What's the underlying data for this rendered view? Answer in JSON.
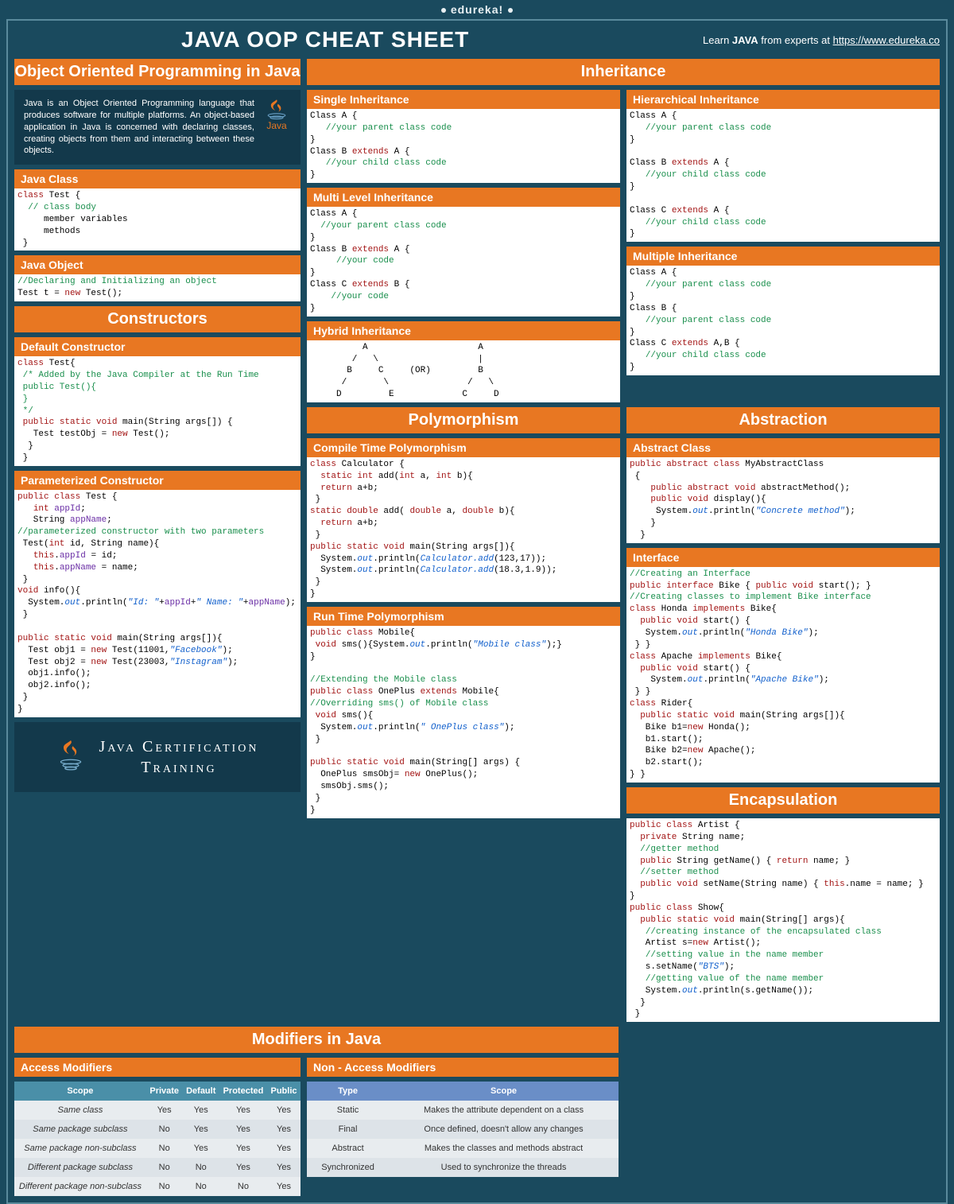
{
  "brand": "edureka!",
  "title": "JAVA OOP CHEAT SHEET",
  "learn_prefix": "Learn ",
  "learn_bold": "JAVA",
  "learn_suffix": " from experts at ",
  "learn_url": "https://www.edureka.co",
  "sec_oop": "Object Oriented Programming in Java",
  "intro": "Java is an Object Oriented Programming language that produces software for multiple platforms. An object-based application in Java is concerned with declaring classes, creating objects from them and interacting between these objects.",
  "java_label": "Java",
  "sec_class": "Java Class",
  "sec_obj": "Java Object",
  "sec_ctor": "Constructors",
  "sec_defctor": "Default Constructor",
  "sec_paramctor": "Parameterized Constructor",
  "cert1": "Java Certification",
  "cert2": "Training",
  "sec_mod": "Modifiers in Java",
  "sec_access": "Access Modifiers",
  "sec_nonaccess": "Non - Access Modifiers",
  "access_headers": [
    "Scope",
    "Private",
    "Default",
    "Protected",
    "Public"
  ],
  "access_rows": [
    [
      "Same class",
      "Yes",
      "Yes",
      "Yes",
      "Yes"
    ],
    [
      "Same package subclass",
      "No",
      "Yes",
      "Yes",
      "Yes"
    ],
    [
      "Same package non-subclass",
      "No",
      "Yes",
      "Yes",
      "Yes"
    ],
    [
      "Different package subclass",
      "No",
      "No",
      "Yes",
      "Yes"
    ],
    [
      "Different package non-subclass",
      "No",
      "No",
      "No",
      "Yes"
    ]
  ],
  "nonaccess_headers": [
    "Type",
    "Scope"
  ],
  "nonaccess_rows": [
    [
      "Static",
      "Makes the attribute dependent on a class"
    ],
    [
      "Final",
      "Once defined, doesn't allow any changes"
    ],
    [
      "Abstract",
      "Makes the classes and methods abstract"
    ],
    [
      "Synchronized",
      "Used to synchronize  the threads"
    ]
  ],
  "sec_inh": "Inheritance",
  "sec_single": "Single Inheritance",
  "sec_hier": "Hierarchical Inheritance",
  "sec_multilvl": "Multi Level Inheritance",
  "sec_multiple": "Multiple Inheritance",
  "sec_hybrid": "Hybrid Inheritance",
  "sec_poly": "Polymorphism",
  "sec_compile": "Compile Time Polymorphism",
  "sec_runtime": "Run Time Polymorphism",
  "sec_abs": "Abstraction",
  "sec_absclass": "Abstract Class",
  "sec_iface": "Interface",
  "sec_encap": "Encapsulation",
  "hybrid_diagram": "          A                     A\n        /   \\                   |\n       B     C     (OR)         B\n      /       \\               /   \\\n     D         E             C     D"
}
